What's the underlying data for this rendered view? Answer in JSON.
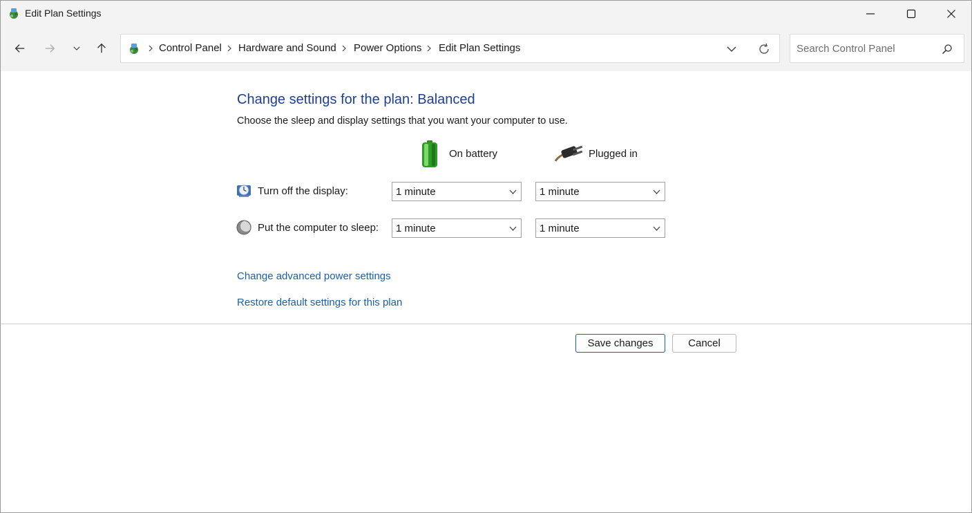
{
  "window": {
    "title": "Edit Plan Settings"
  },
  "breadcrumb": [
    "Control Panel",
    "Hardware and Sound",
    "Power Options",
    "Edit Plan Settings"
  ],
  "search": {
    "placeholder": "Search Control Panel"
  },
  "main": {
    "heading": "Change settings for the plan: Balanced",
    "description": "Choose the sleep and display settings that you want your computer to use.",
    "columns": {
      "battery": "On battery",
      "plugged": "Plugged in"
    },
    "rows": [
      {
        "label": "Turn off the display:",
        "battery_value": "1 minute",
        "plugged_value": "1 minute"
      },
      {
        "label": "Put the computer to sleep:",
        "battery_value": "1 minute",
        "plugged_value": "1 minute"
      }
    ],
    "links": {
      "advanced": "Change advanced power settings",
      "restore": "Restore default settings for this plan"
    }
  },
  "buttons": {
    "save": "Save changes",
    "cancel": "Cancel"
  },
  "colors": {
    "heading": "#1e3f8f",
    "link": "#1a5fa8",
    "chrome": "#f3f3f3"
  },
  "icons": [
    "control-panel-icon",
    "back-icon",
    "forward-icon",
    "recent-icon",
    "up-icon",
    "refresh-icon",
    "search-icon",
    "battery-icon",
    "plug-icon",
    "display-icon",
    "sleep-icon"
  ]
}
